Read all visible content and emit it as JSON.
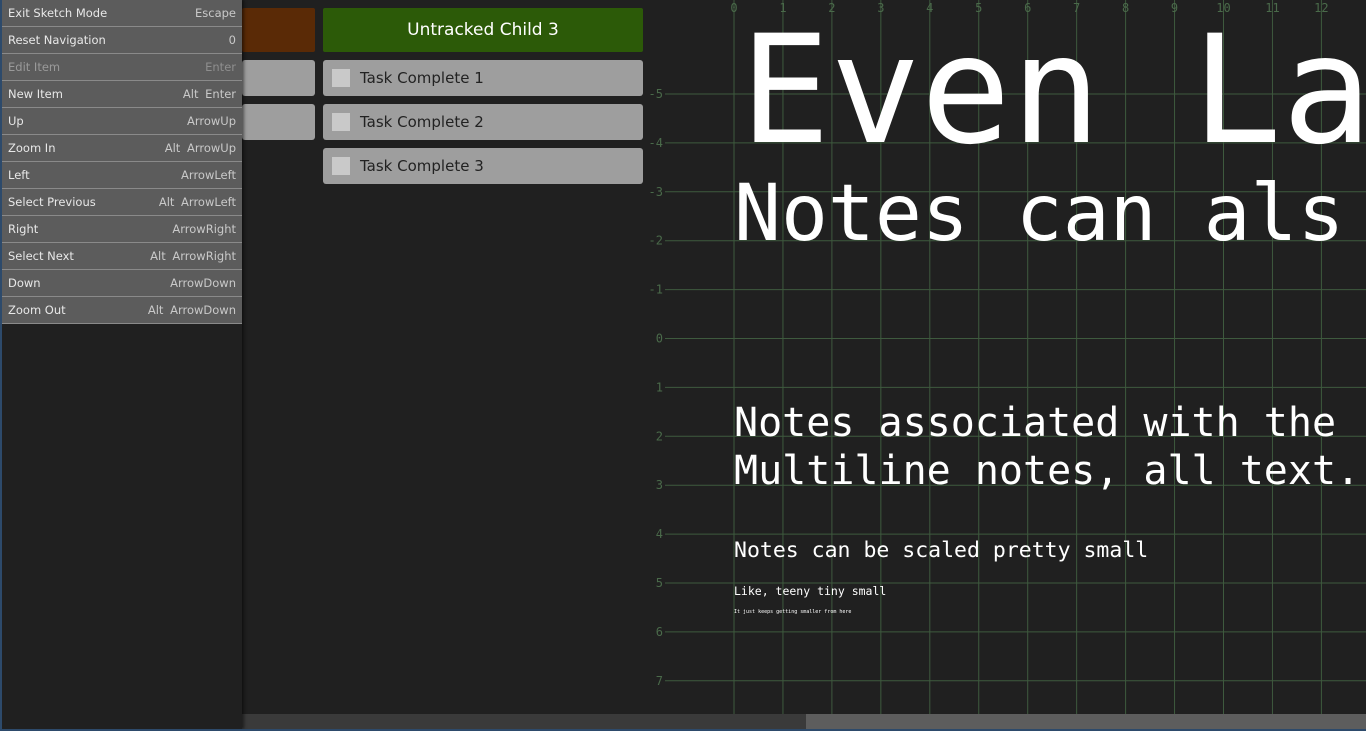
{
  "palette": {
    "commands": [
      {
        "label": "Exit Sketch Mode",
        "shortcut": "Escape",
        "enabled": true
      },
      {
        "label": "Reset Navigation",
        "shortcut": "0",
        "enabled": true
      },
      {
        "label": "Edit Item",
        "shortcut": "Enter",
        "enabled": false
      },
      {
        "label": "New Item",
        "shortcut": "Alt Enter",
        "enabled": true
      },
      {
        "label": "Up",
        "shortcut": "ArrowUp",
        "enabled": true
      },
      {
        "label": "Zoom In",
        "shortcut": "Alt ArrowUp",
        "enabled": true
      },
      {
        "label": "Left",
        "shortcut": "ArrowLeft",
        "enabled": true
      },
      {
        "label": "Select Previous",
        "shortcut": "Alt ArrowLeft",
        "enabled": true
      },
      {
        "label": "Right",
        "shortcut": "ArrowRight",
        "enabled": true
      },
      {
        "label": "Select Next",
        "shortcut": "Alt ArrowRight",
        "enabled": true
      },
      {
        "label": "Down",
        "shortcut": "ArrowDown",
        "enabled": true
      },
      {
        "label": "Zoom Out",
        "shortcut": "Alt ArrowDown",
        "enabled": true
      }
    ]
  },
  "tree": {
    "header_node": "Untracked Child 3",
    "tasks": [
      "Task Complete 1",
      "Task Complete 2",
      "Task Complete 3"
    ],
    "colors": {
      "orange": "#5a2a06",
      "green": "#2c5a08",
      "grey": "#9e9e9e"
    }
  },
  "sketch": {
    "x_ticks": [
      "0",
      "1",
      "2",
      "3",
      "4",
      "5",
      "6",
      "7",
      "8",
      "9",
      "10",
      "11",
      "12"
    ],
    "y_ticks": [
      "-5",
      "-4",
      "-3",
      "-2",
      "-1",
      "0",
      "1",
      "2",
      "3",
      "4",
      "5",
      "6",
      "7"
    ],
    "notes": {
      "large_title": "Even La",
      "medium_title": "Notes can als",
      "multiline_1": "Notes associated with the",
      "multiline_2": "Multiline notes, all text.",
      "small": "Notes can be scaled pretty small",
      "teeny": "Like, teeny tiny small",
      "tiniest": "It just keeps getting smaller from here"
    },
    "grid_color": "#3e5a3e"
  },
  "scrollbar": {
    "position_fraction": 0.5
  }
}
